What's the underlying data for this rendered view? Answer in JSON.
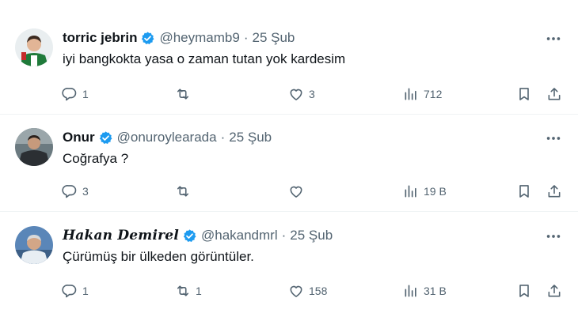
{
  "tweets": [
    {
      "name": "torric jebrin",
      "handle": "@heymamb9",
      "separator": "·",
      "date": "25 Şub",
      "text": "iyi bangkokta yasa o zaman tutan yok kardesim",
      "replies": "1",
      "retweets": "",
      "likes": "3",
      "views": "712"
    },
    {
      "name": "Onur",
      "handle": "@onuroylearada",
      "separator": "·",
      "date": "25 Şub",
      "text": "Coğrafya ?",
      "replies": "3",
      "retweets": "",
      "likes": "",
      "views": "19 B"
    },
    {
      "name": "Hakan Demirel",
      "handle": "@hakandmrl",
      "separator": "·",
      "date": "25 Şub",
      "text": "Çürümüş bir ülkeden görüntüler.",
      "replies": "1",
      "retweets": "1",
      "likes": "158",
      "views": "31 B"
    }
  ],
  "colors": {
    "verified": "#1d9bf0",
    "secondary_text": "#536471",
    "primary_text": "#0f1419",
    "divider": "#eff3f4"
  },
  "icons": [
    "verified-badge-icon",
    "more-icon",
    "reply-icon",
    "retweet-icon",
    "like-icon",
    "views-icon",
    "bookmark-icon",
    "share-icon"
  ]
}
